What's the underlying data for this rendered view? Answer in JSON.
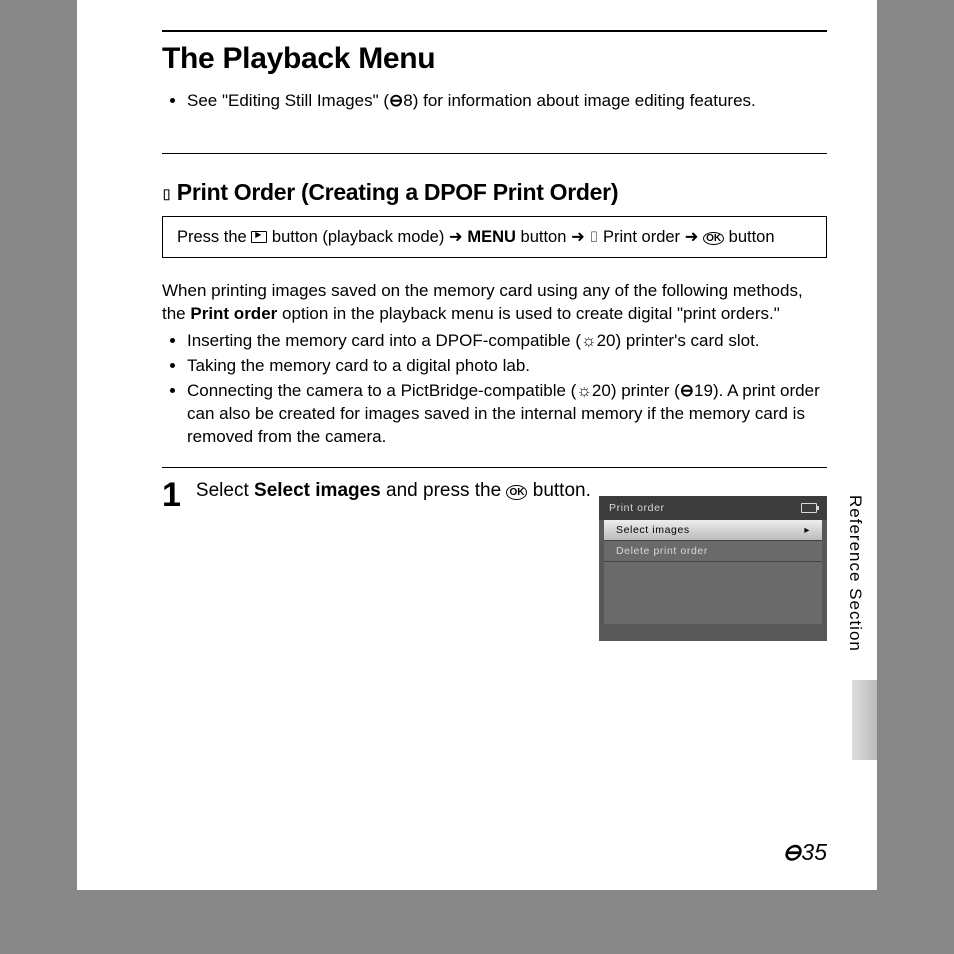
{
  "title": "The Playback Menu",
  "intro": {
    "bullet1_pre": "See \"Editing Still Images\" (",
    "bullet1_ref": "8",
    "bullet1_post": ") for information about image editing features."
  },
  "section": {
    "heading": "Print Order (Creating a DPOF Print Order)",
    "nav_press_the": "Press the ",
    "nav_playback_button": " button (playback mode) ",
    "nav_menu": " MENU",
    "nav_button_text": " button ",
    "nav_print_order": " Print order ",
    "nav_ok_button": " button",
    "para1_pre": "When printing images saved on the memory card using any of the following methods, the ",
    "para1_bold": "Print order",
    "para1_post": " option in the playback menu is used to create digital \"print orders.\"",
    "bullets": {
      "b1_pre": "Inserting the memory card into a DPOF-compatible (",
      "b1_ref": "20",
      "b1_post": ") printer's card slot.",
      "b2": "Taking the memory card to a digital photo lab.",
      "b3_pre": "Connecting the camera to a PictBridge-compatible (",
      "b3_ref1": "20",
      "b3_mid": ") printer (",
      "b3_ref2": "19",
      "b3_post": "). A print order can also be created for images saved in the internal memory if the memory card is removed from the camera."
    }
  },
  "step1": {
    "num": "1",
    "text_pre": "Select ",
    "text_bold": "Select images",
    "text_mid": " and press the ",
    "text_post": " button."
  },
  "screenshot": {
    "title": "Print order",
    "item1": "Select images",
    "item2": "Delete print order"
  },
  "side": "Reference Section",
  "footer": "35"
}
